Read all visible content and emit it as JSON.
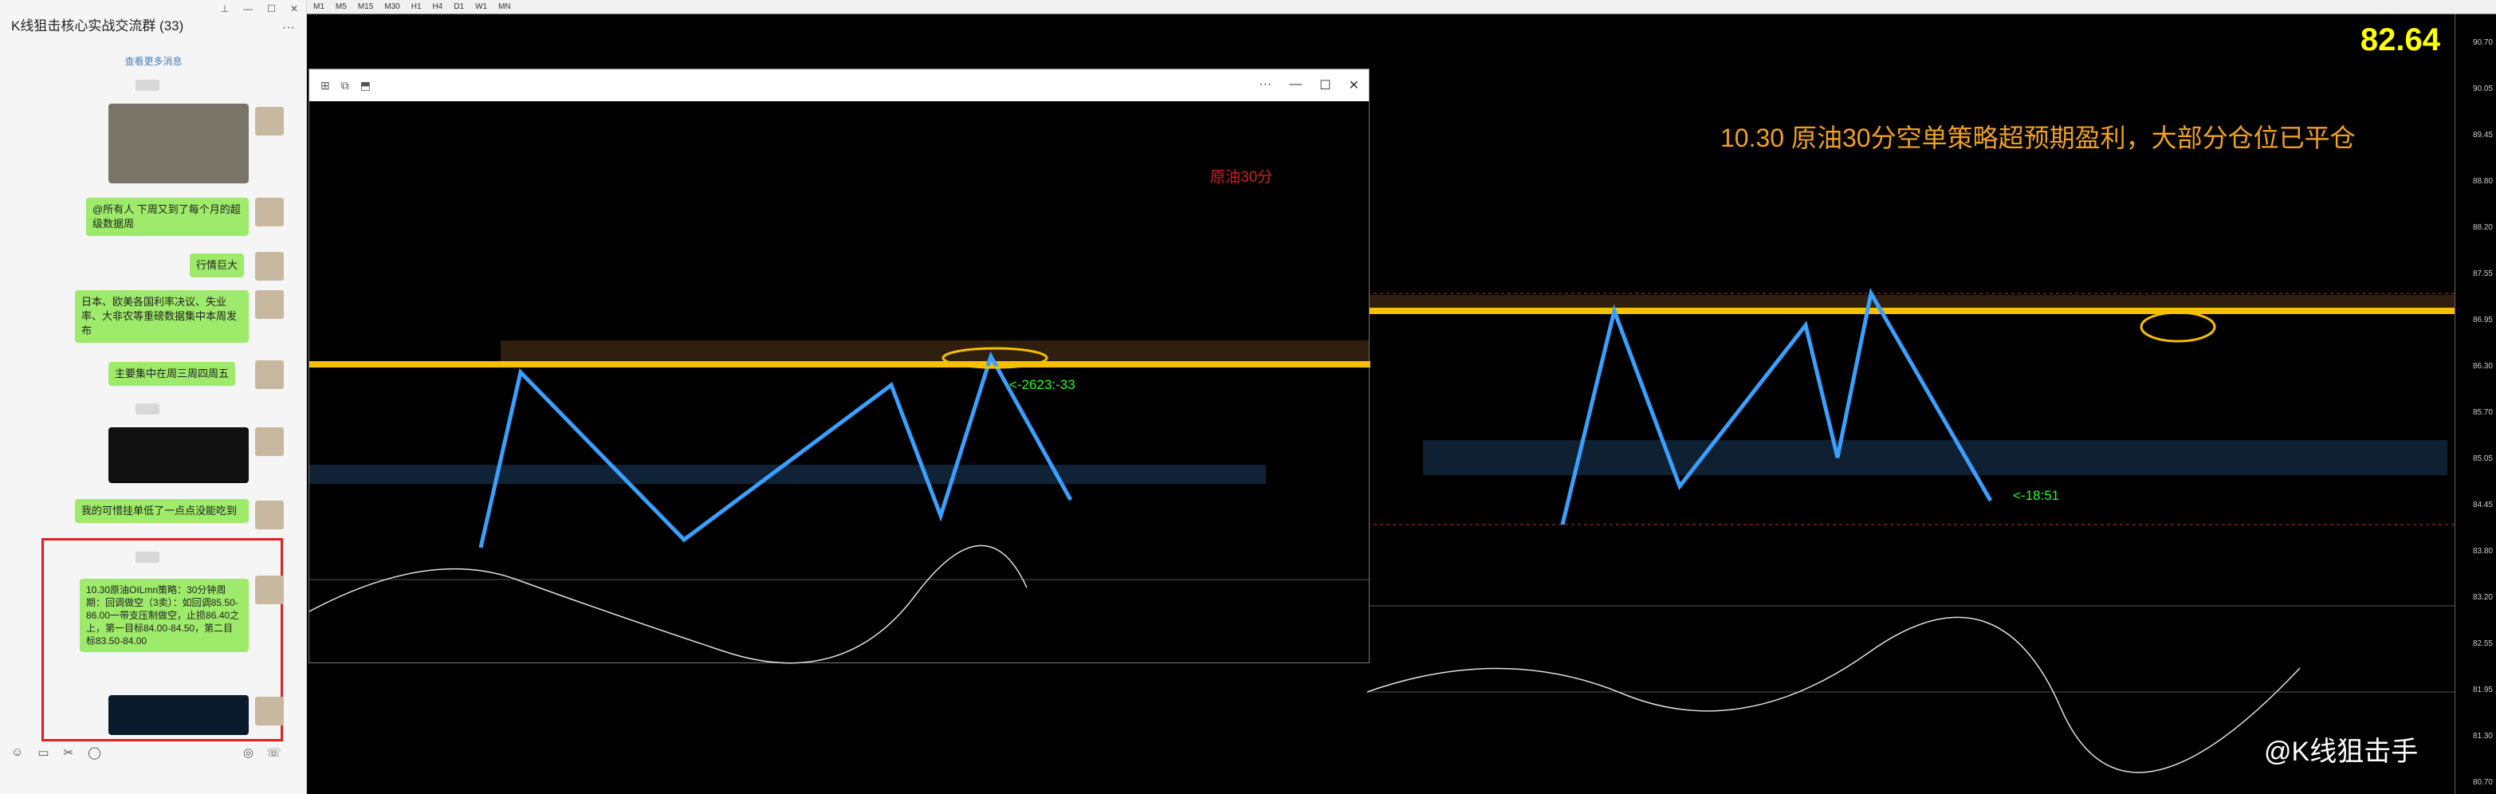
{
  "chat": {
    "title": "K线狙击核心实战交流群 (33)",
    "view_more": "查看更多消息",
    "messages": [
      "@所有人 下周又到了每个月的超级数据周",
      "行情巨大",
      "日本、欧美各国利率决议、失业率、大非农等重磅数据集中本周发布",
      "主要集中在周三周四周五",
      "我的可惜挂单低了一点点没能吃到",
      "10.30原油OILmn策略：30分钟周期：回调做空（3卖）：如回调85.50-86.00一带支压制做空，止损86.40之上，第一目标84.00-84.50，第二目标83.50-84.00"
    ]
  },
  "mt4": {
    "price": "82.64",
    "headline": "10.30 原油30分空单策略超预期盈利，大部分仓位已平仓",
    "subchart_title": "原油30分",
    "tag_left": "<-2623:-33",
    "tag_right": "<-18:51",
    "watermark": "@K线狙击手",
    "toolbar": [
      "M1",
      "M5",
      "M15",
      "M30",
      "H1",
      "H4",
      "D1",
      "W1",
      "MN"
    ],
    "axis": [
      "90.70",
      "90.05",
      "89.45",
      "88.80",
      "88.20",
      "87.55",
      "86.95",
      "86.30",
      "85.70",
      "85.05",
      "84.45",
      "83.80",
      "83.20",
      "82.55",
      "81.95",
      "81.30",
      "80.70"
    ]
  }
}
